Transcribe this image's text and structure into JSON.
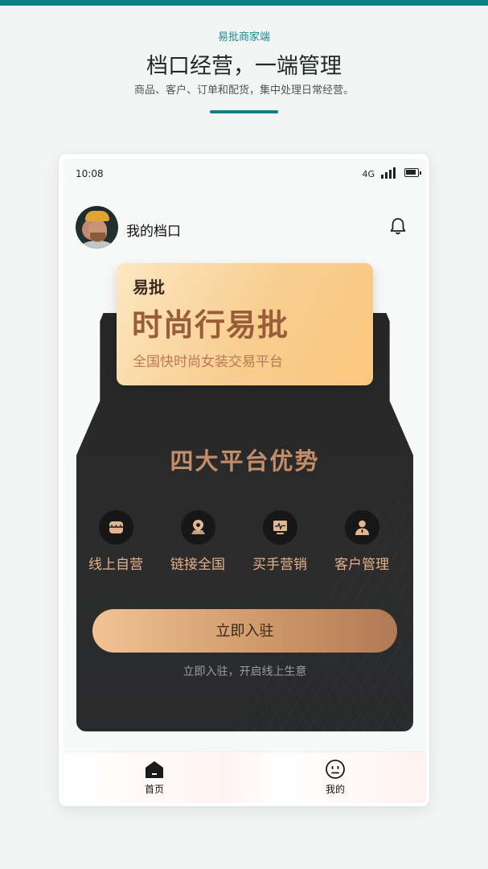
{
  "promo": {
    "label": "易批商家端",
    "title": "档口经营，一端管理",
    "subtitle": "商品、客户、订单和配货，集中处理日常经营。"
  },
  "status_bar": {
    "time": "10:08",
    "network": "4G",
    "signal_icon": "signal-icon",
    "battery_icon": "battery-icon"
  },
  "header": {
    "store_name": "我的档口",
    "avatar_icon": "avatar",
    "bell_icon": "bell-icon"
  },
  "ticket": {
    "brand": "易批",
    "title": "时尚行易批",
    "subtitle": "全国快时尚女装交易平台"
  },
  "advantages": {
    "title": "四大平台优势",
    "items": [
      {
        "label": "线上自营",
        "icon": "store-icon"
      },
      {
        "label": "链接全国",
        "icon": "location-icon"
      },
      {
        "label": "买手营销",
        "icon": "monitor-icon"
      },
      {
        "label": "客户管理",
        "icon": "customer-icon"
      }
    ]
  },
  "cta": {
    "button_label": "立即入驻",
    "hint": "立即入驻，开启线上生意"
  },
  "tabbar": {
    "home_label": "首页",
    "me_label": "我的"
  },
  "colors": {
    "accent": "#0e7e82",
    "card_dark": "#2a2a2b",
    "gold": "#c48d6a",
    "ticket_gold": "#f7cd8e"
  }
}
